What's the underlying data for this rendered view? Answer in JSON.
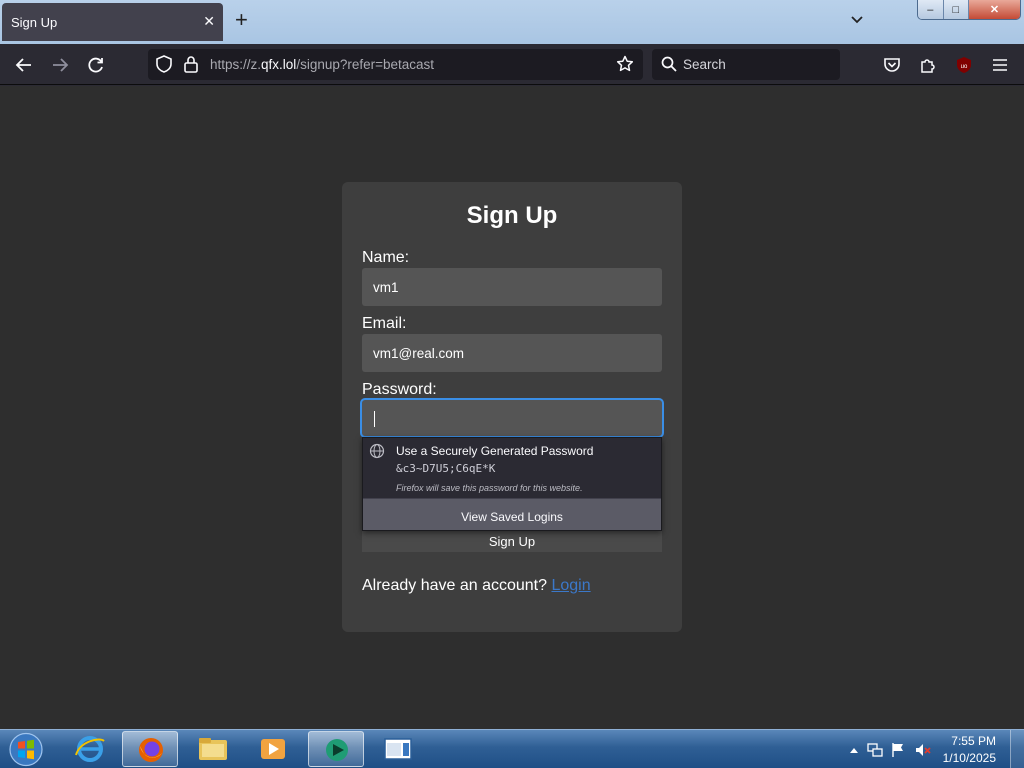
{
  "browser": {
    "tab_title": "Sign Up",
    "tab_close": "✕",
    "new_tab": "+",
    "url_prefix": "https://z.",
    "url_domain": "qfx.lol",
    "url_path": "/signup?refer=betacast",
    "search_placeholder": "Search",
    "addon_badge": "uo"
  },
  "window_controls": {
    "minimize": "–",
    "maximize": "□",
    "close": "✕"
  },
  "page": {
    "title": "Sign Up",
    "name_label": "Name:",
    "name_value": "vm1",
    "email_label": "Email:",
    "email_value": "vm1@real.com",
    "password_label": "Password:",
    "password_value": "",
    "submit_label": "Sign Up",
    "account_prompt": "Already have an account?",
    "login_link": "Login"
  },
  "autocomplete": {
    "title": "Use a Securely Generated Password",
    "generated_password": "&c3~D7U5;C6qE*K",
    "note": "Firefox will save this password for this website.",
    "footer": "View Saved Logins"
  },
  "taskbar": {
    "time": "7:55 PM",
    "date": "1/10/2025"
  },
  "colors": {
    "page_bg": "#2e2e2e",
    "card_bg": "#3e3e3e",
    "input_bg": "#555555",
    "focus_ring": "#3a8ee6",
    "link": "#3b78c9"
  }
}
